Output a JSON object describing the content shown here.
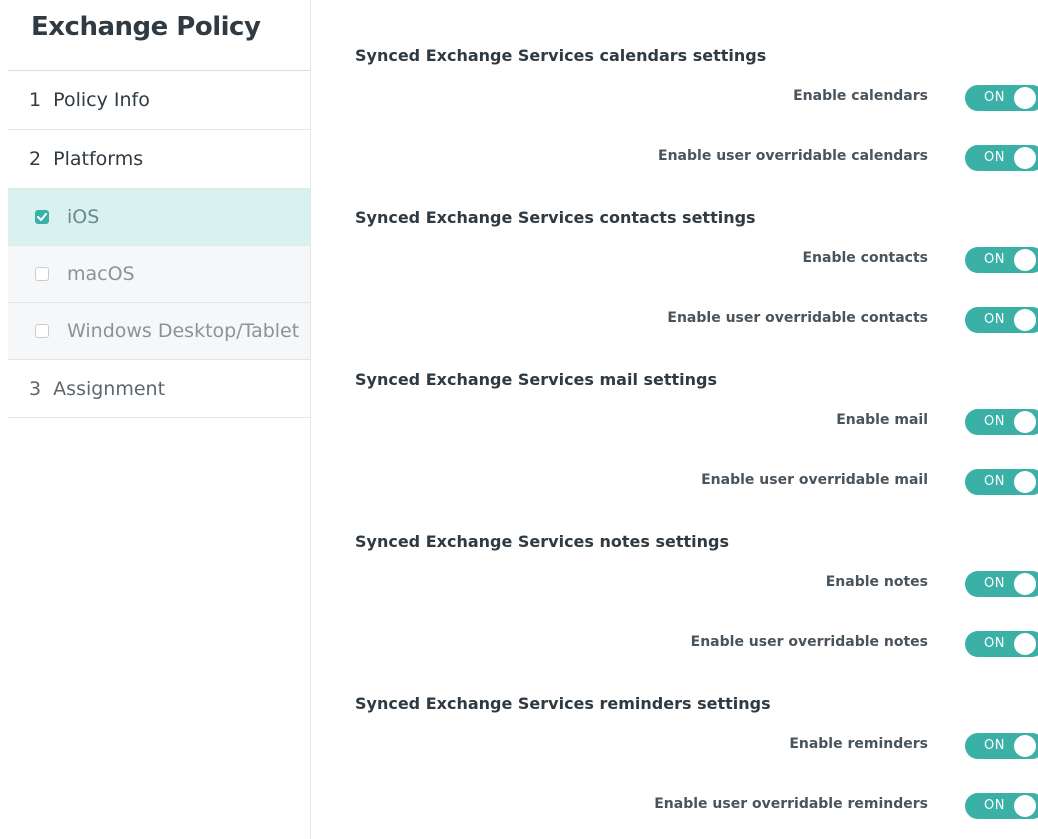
{
  "sidebar": {
    "title": "Exchange Policy",
    "steps": [
      {
        "label": "1  Policy Info"
      },
      {
        "label": "2  Platforms"
      },
      {
        "label": "3  Assignment"
      }
    ],
    "platforms": [
      {
        "label": "iOS",
        "checked": true,
        "active": true
      },
      {
        "label": "macOS",
        "checked": false,
        "active": false
      },
      {
        "label": "Windows Desktop/Tablet",
        "checked": false,
        "active": false
      }
    ]
  },
  "sections": [
    {
      "title": "Synced Exchange Services calendars settings",
      "settings": [
        {
          "label": "Enable calendars",
          "state": "ON"
        },
        {
          "label": "Enable user overridable calendars",
          "state": "ON"
        }
      ]
    },
    {
      "title": "Synced Exchange Services contacts settings",
      "settings": [
        {
          "label": "Enable contacts",
          "state": "ON"
        },
        {
          "label": "Enable user overridable contacts",
          "state": "ON"
        }
      ]
    },
    {
      "title": "Synced Exchange Services mail settings",
      "settings": [
        {
          "label": "Enable mail",
          "state": "ON"
        },
        {
          "label": "Enable user overridable mail",
          "state": "ON"
        }
      ]
    },
    {
      "title": "Synced Exchange Services notes settings",
      "settings": [
        {
          "label": "Enable notes",
          "state": "ON"
        },
        {
          "label": "Enable user overridable notes",
          "state": "ON"
        }
      ]
    },
    {
      "title": "Synced Exchange Services reminders settings",
      "settings": [
        {
          "label": "Enable reminders",
          "state": "ON"
        },
        {
          "label": "Enable user overridable reminders",
          "state": "ON"
        }
      ]
    }
  ],
  "colors": {
    "accent": "#3ab0a6",
    "active_row": "#d9f1ef"
  }
}
